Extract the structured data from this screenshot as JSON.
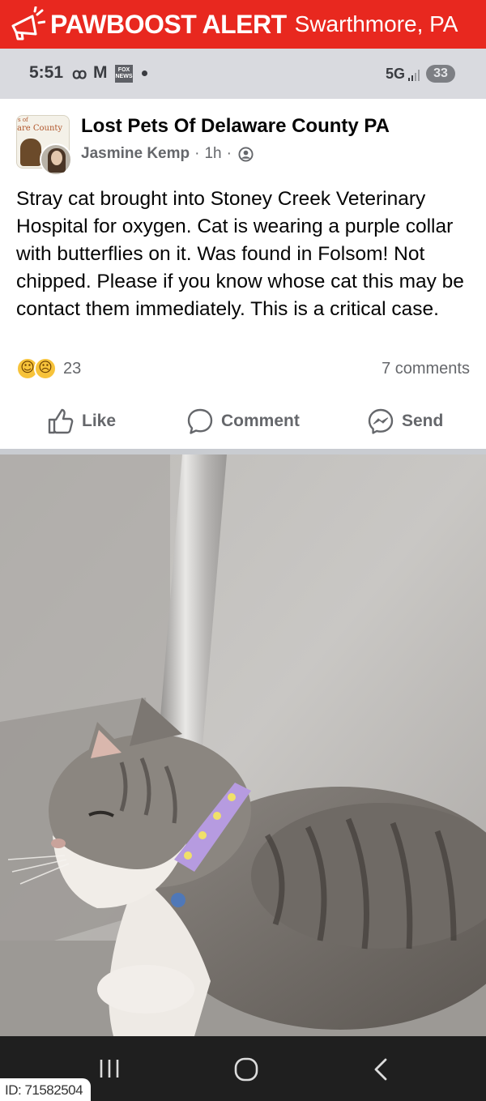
{
  "banner": {
    "brand": "PAWBOOST ALERT",
    "location": "Swarthmore, PA",
    "icon": "megaphone-icon",
    "color": "#e8281f"
  },
  "status_bar": {
    "time": "5:51",
    "network": "5G",
    "battery": "33",
    "notification_icons": [
      "voicemail-icon",
      "gmail-icon",
      "fox-news-icon",
      "dot-icon"
    ]
  },
  "post": {
    "group_name": "Lost Pets Of Delaware County PA",
    "group_avatar_text_1": "s of",
    "group_avatar_text_2": "are County",
    "author": "Jasmine Kemp",
    "time": "1h",
    "separator": "·",
    "privacy_icon": "group-members-icon",
    "text": "Stray cat brought into Stoney Creek Veterinary Hospital for oxygen. Cat is wearing a purple collar with butterflies on it. Was found in Folsom! Not chipped. Please if you know whose cat this may be contact them immediately. This is a critical case.",
    "reactions": {
      "icons": [
        "care-reaction-icon",
        "sad-reaction-icon"
      ],
      "count": "23"
    },
    "comments": "7 comments",
    "actions": {
      "like": "Like",
      "comment": "Comment",
      "send": "Send"
    }
  },
  "nav": {
    "recents_icon": "recents-icon",
    "home_icon": "home-icon",
    "back_icon": "back-icon"
  },
  "image_id": "ID: 71582504"
}
